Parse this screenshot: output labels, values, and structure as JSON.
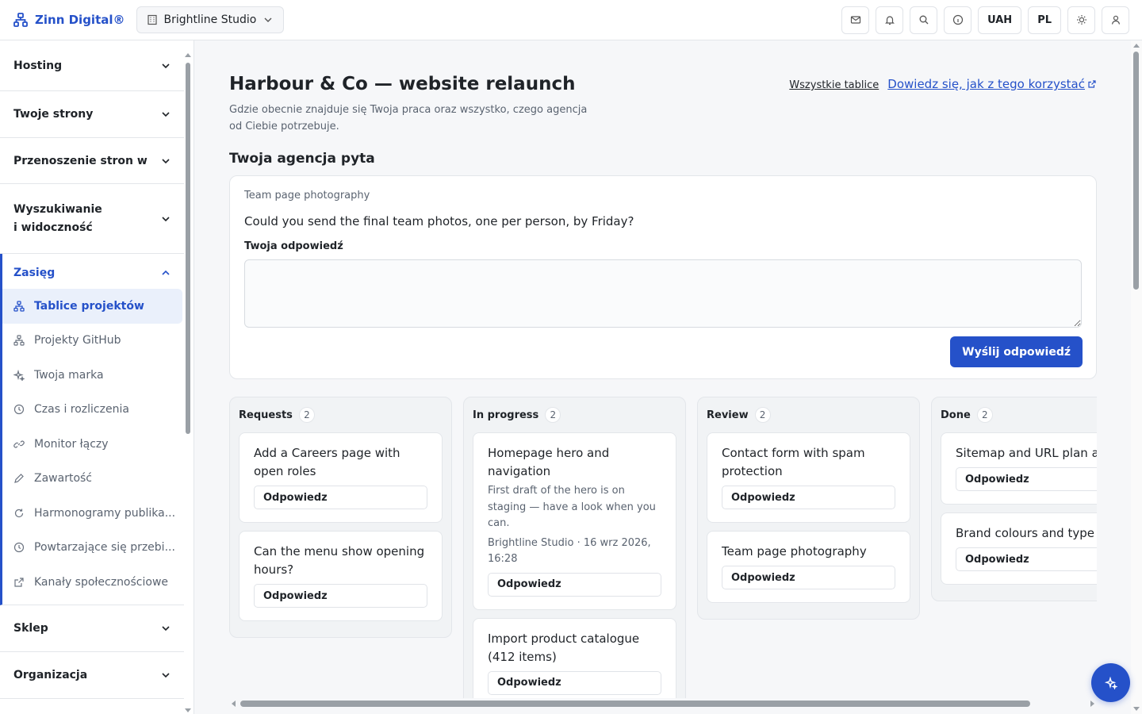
{
  "brand": {
    "name": "Zinn Digital®",
    "icon": "org-chart-icon"
  },
  "studio": {
    "name": "Brightline Studio"
  },
  "topbar": {
    "currency": "UAH",
    "language": "PL"
  },
  "sidebar": {
    "sections": [
      {
        "label": "Hosting"
      },
      {
        "label": "Twoje strony"
      },
      {
        "label": "Przenoszenie stron w"
      },
      {
        "label": "Wyszukiwanie\ni widoczność"
      },
      {
        "label": "Zasięg"
      },
      {
        "label": "Sklep"
      },
      {
        "label": "Organizacja"
      }
    ],
    "items": [
      {
        "label": "Tablice projektów",
        "icon": "org-chart-icon",
        "active": true
      },
      {
        "label": "Projekty GitHub",
        "icon": "org-chart-icon"
      },
      {
        "label": "Twoja marka",
        "icon": "sparkle-icon"
      },
      {
        "label": "Czas i rozliczenia",
        "icon": "clock-icon"
      },
      {
        "label": "Monitor łączy",
        "icon": "link-icon"
      },
      {
        "label": "Zawartość",
        "icon": "pencil-icon"
      },
      {
        "label": "Harmonogramy publika...",
        "icon": "refresh-icon"
      },
      {
        "label": "Powtarzające się przebi...",
        "icon": "clock-icon"
      },
      {
        "label": "Kanały społecznościowe",
        "icon": "external-link-icon"
      }
    ]
  },
  "page": {
    "title": "Harbour & Co — website relaunch",
    "description": "Gdzie obecnie znajduje się Twoja praca oraz wszystko, czego agencja od Ciebie potrzebuje.",
    "all_boards_link": "Wszystkie tablice",
    "learn_link": "Dowiedz się, jak z tego korzystać"
  },
  "ask": {
    "heading": "Twoja agencja pyta",
    "tag": "Team page photography",
    "question": "Could you send the final team photos, one per person, by Friday?",
    "answer_label": "Twoja odpowiedź",
    "answer_value": "",
    "send_label": "Wyślij odpowiedź"
  },
  "board": {
    "reply_label": "Odpowiedz",
    "columns": [
      {
        "title": "Requests",
        "count": "2",
        "cards": [
          {
            "title": "Add a Careers page with open roles"
          },
          {
            "title": "Can the menu show opening hours?"
          }
        ]
      },
      {
        "title": "In progress",
        "count": "2",
        "cards": [
          {
            "title": "Homepage hero and navigation",
            "note": "First draft of the hero is on staging — have a look when you can.",
            "meta": "Brightline Studio · 16 wrz 2026, 16:28"
          },
          {
            "title": "Import product catalogue (412 items)"
          }
        ]
      },
      {
        "title": "Review",
        "count": "2",
        "cards": [
          {
            "title": "Contact form with spam protection"
          },
          {
            "title": "Team page photography"
          }
        ]
      },
      {
        "title": "Done",
        "count": "2",
        "cards": [
          {
            "title": "Sitemap and URL plan agreed"
          },
          {
            "title": "Brand colours and type set"
          }
        ]
      }
    ]
  },
  "colors": {
    "accent": "#2551c9",
    "active_bg": "#eaf0fb"
  }
}
